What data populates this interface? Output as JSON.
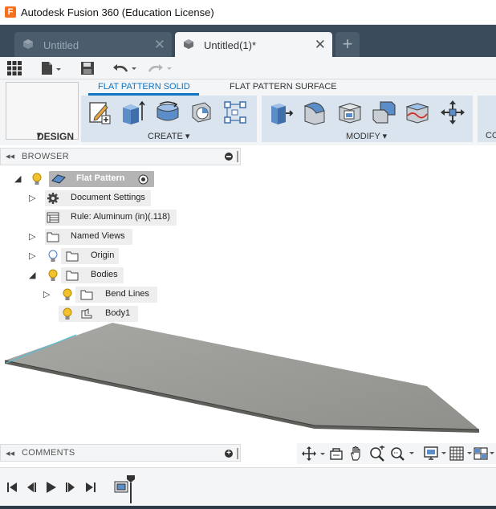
{
  "window": {
    "title": "Autodesk Fusion 360 (Education License)",
    "app_logo_letter": "F"
  },
  "doc_tabs": [
    {
      "label": "Untitled",
      "active": false
    },
    {
      "label": "Untitled(1)*",
      "active": true
    }
  ],
  "new_tab_label": "+",
  "workspace_button": {
    "label": "DESIGN",
    "arrow": "▾"
  },
  "ribbon_tabs": [
    {
      "label": "FLAT PATTERN SOLID",
      "active": true
    },
    {
      "label": "FLAT PATTERN SURFACE",
      "active": false
    }
  ],
  "ribbon_groups": {
    "create": {
      "label": "CREATE ▾",
      "tools": [
        "create-sketch-icon",
        "extrude-icon",
        "revolve-icon",
        "sweep-icon",
        "pattern-icon"
      ]
    },
    "modify": {
      "label": "MODIFY ▾",
      "tools": [
        "press-pull-icon",
        "fillet-icon",
        "shell-icon",
        "combine-icon",
        "replace-face-icon",
        "move-icon"
      ]
    },
    "construct": {
      "label": "CO"
    }
  },
  "browser": {
    "title": "BROWSER",
    "tree": [
      {
        "label": "Flat Pattern"
      },
      {
        "label": "Document Settings"
      },
      {
        "label": "Rule: Aluminum (in)(.118)"
      },
      {
        "label": "Named Views"
      },
      {
        "label": "Origin"
      },
      {
        "label": "Bodies"
      },
      {
        "label": "Bend Lines"
      },
      {
        "label": "Body1"
      }
    ]
  },
  "comments": {
    "title": "COMMENTS"
  },
  "colors": {
    "accent": "#0e74c4",
    "tabstrip": "#3a4b5c",
    "ribbon_group": "#d9e4ef",
    "body": "#a9aaa6",
    "bend_line": "#4fc1d9"
  }
}
